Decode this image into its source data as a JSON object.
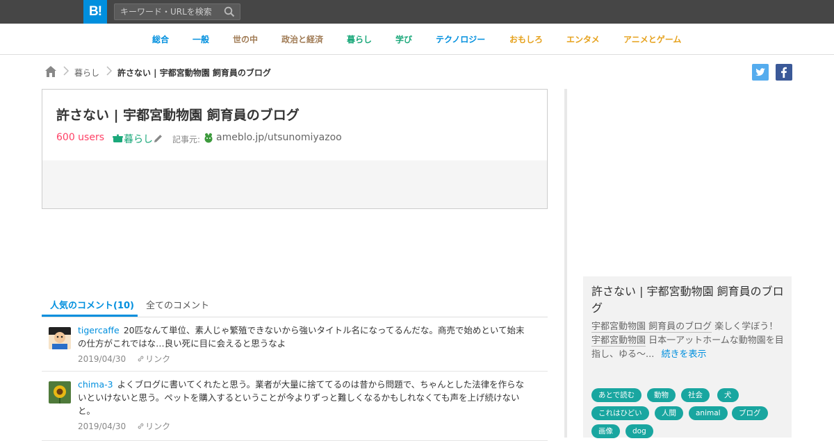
{
  "header": {
    "logo_text": "B!",
    "search_placeholder": "キーワード・URLを検索",
    "brand_color": "#008fde"
  },
  "categories": [
    {
      "label": "総合",
      "color": "#008fde"
    },
    {
      "label": "一般",
      "color": "#008fde"
    },
    {
      "label": "世の中",
      "color": "#a07b55"
    },
    {
      "label": "政治と経済",
      "color": "#a07b55"
    },
    {
      "label": "暮らし",
      "color": "#1aa87a"
    },
    {
      "label": "学び",
      "color": "#1aa87a"
    },
    {
      "label": "テクノロジー",
      "color": "#008fde"
    },
    {
      "label": "おもしろ",
      "color": "#e6a21e"
    },
    {
      "label": "エンタメ",
      "color": "#e6a21e"
    },
    {
      "label": "アニメとゲーム",
      "color": "#e6a21e"
    }
  ],
  "breadcrumb": {
    "home_icon": "home-icon",
    "items": [
      "暮らし",
      "許さない | 宇都宮動物園 飼育員のブログ"
    ]
  },
  "share": {
    "twitter_icon": "twitter-icon",
    "facebook_icon": "facebook-icon"
  },
  "entry": {
    "title": "許さない | 宇都宮動物園 飼育員のブログ",
    "users": "600 users",
    "category": "暮らし",
    "source_label": "記事元:",
    "source_domain": "ameblo.jp/utsunomiyazoo"
  },
  "comments_tabs": [
    {
      "label": "人気のコメント(10)",
      "active": true
    },
    {
      "label": "全てのコメント",
      "active": false
    }
  ],
  "comments": [
    {
      "user": "tigercaffe",
      "text": "20匹なんて単位、素人じゃ繁殖できないから強いタイトル名になってるんだな。商売で始めといて始末の仕方がこれではな…良い死に目に会えると思うなよ",
      "date": "2019/04/30",
      "link_label": "リンク"
    },
    {
      "user": "chima-3",
      "text": "よくブログに書いてくれたと思う。業者が大量に捨ててるのは昔から問題で、ちゃんとした法律を作らないといけないと思う。ペットを購入するということが今よりずっと難しくなるかもしれなくても声を上げ続けないと。",
      "date": "2019/04/30",
      "link_label": "リンク"
    }
  ],
  "sidebar": {
    "title": "許さない | 宇都宮動物園 飼育員のブログ",
    "desc_part1": "宇都宮動物園 飼育員のブログ",
    "desc_part2": " 楽しく学ぼう！",
    "desc_part3": "宇都宮動物園",
    "desc_part4": " 日本一アットホームな動物園を目指し、ゆる～...",
    "more_label": "続きを表示",
    "tags": [
      "あとで読む",
      "動物",
      "社会",
      "犬",
      "これはひどい",
      "人間",
      "animal",
      "ブログ",
      "画像",
      "dog"
    ],
    "tag_color": "#19a6a0"
  }
}
